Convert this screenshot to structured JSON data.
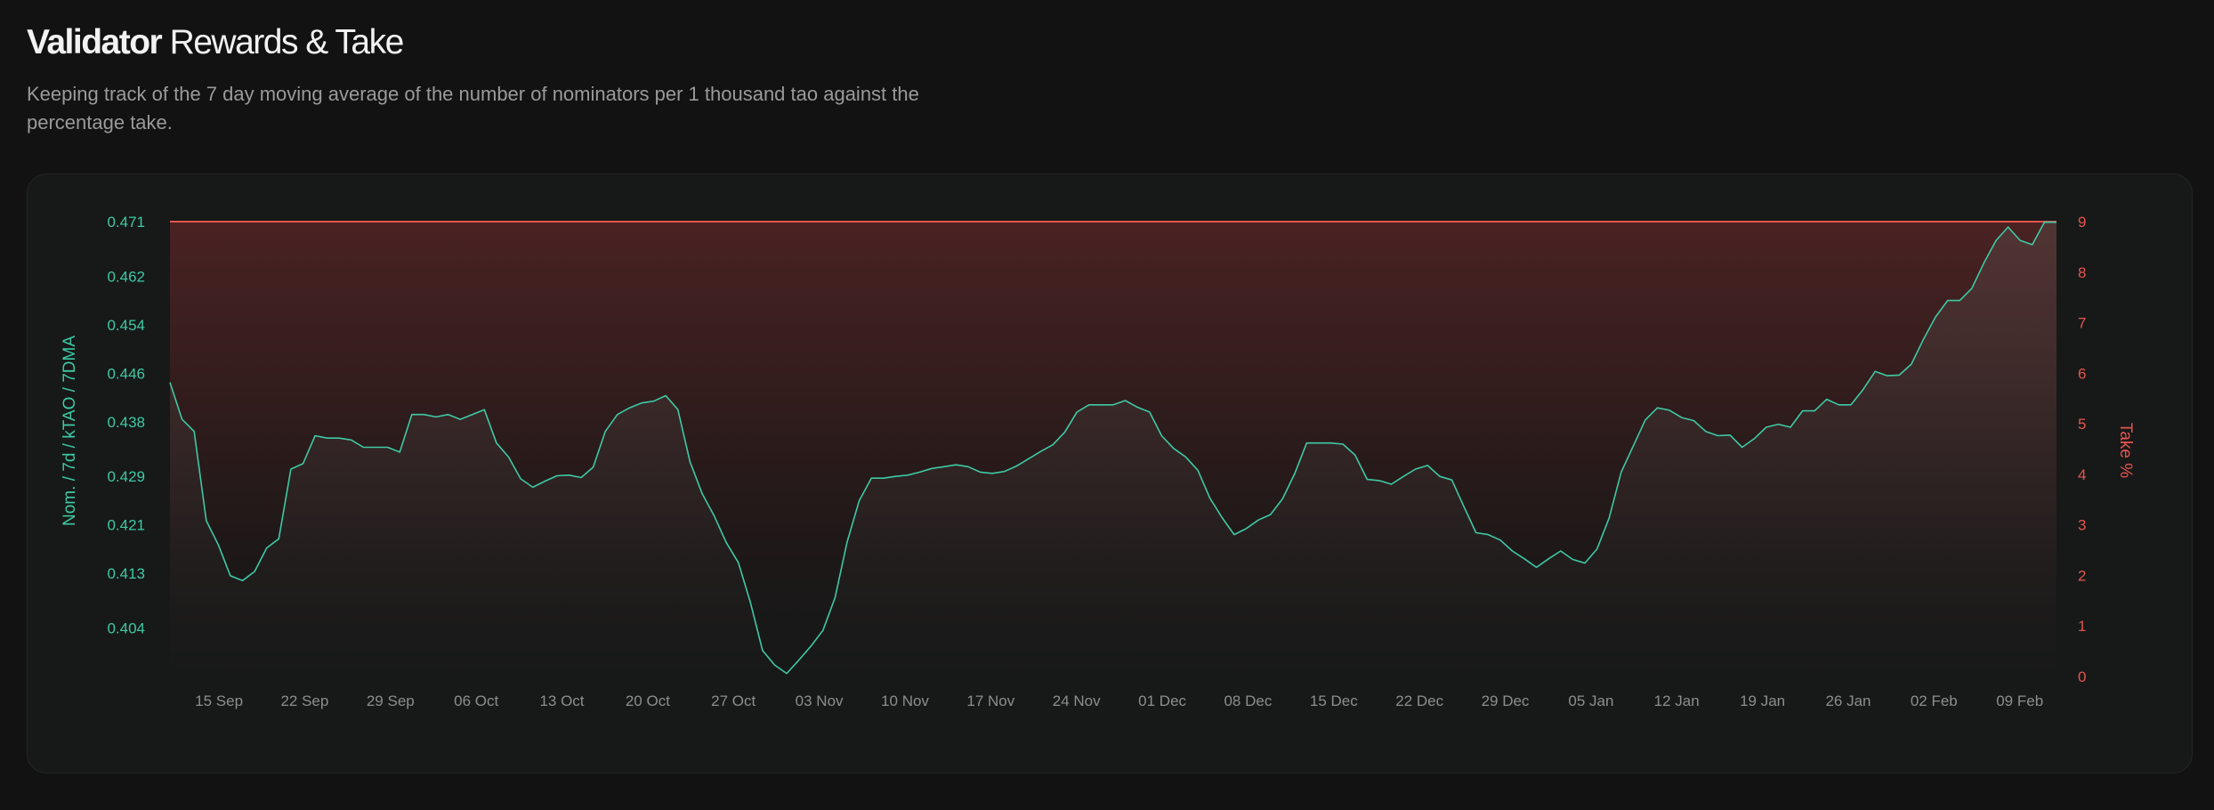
{
  "header": {
    "title_strong": "Validator",
    "title_rest": " Rewards & Take",
    "subtitle": "Keeping track of the 7 day moving average of the number of nominators per 1 thousand tao against the percentage take."
  },
  "colors": {
    "background": "#121212",
    "card": "#171918",
    "nominator_line": "#3ec9a4",
    "take_line": "#e5554d",
    "take_fill_top": "#4a2222",
    "x_tick": "#8d8d8d"
  },
  "chart_data": {
    "type": "line",
    "ylabel_left": "Nom. / 7d / kTAO / 7DMA",
    "ylabel_right": "Take %",
    "y_left_ticks": [
      "0.404",
      "0.413",
      "0.421",
      "0.429",
      "0.438",
      "0.446",
      "0.454",
      "0.462",
      "0.471"
    ],
    "y_left_range": [
      0.396,
      0.471
    ],
    "y_right_ticks": [
      "0",
      "1",
      "2",
      "3",
      "4",
      "5",
      "6",
      "7",
      "8",
      "9"
    ],
    "y_right_range": [
      0,
      9
    ],
    "x_ticks": [
      "15 Sep",
      "22 Sep",
      "29 Sep",
      "06 Oct",
      "13 Oct",
      "20 Oct",
      "27 Oct",
      "03 Nov",
      "10 Nov",
      "17 Nov",
      "24 Nov",
      "01 Dec",
      "08 Dec",
      "15 Dec",
      "22 Dec",
      "29 Dec",
      "05 Jan",
      "12 Jan",
      "19 Jan",
      "26 Jan",
      "02 Feb",
      "09 Feb"
    ],
    "x_start_date": "2023-09-11",
    "x_end_date": "2024-02-12",
    "series": [
      {
        "name": "Nom. / 7d / kTAO / 7DMA",
        "axis": "left",
        "values": [
          0.4445,
          0.4384,
          0.4364,
          0.4217,
          0.4177,
          0.4126,
          0.4118,
          0.4133,
          0.4172,
          0.4187,
          0.4302,
          0.4311,
          0.4357,
          0.4353,
          0.4353,
          0.435,
          0.4338,
          0.4338,
          0.4338,
          0.433,
          0.4392,
          0.4392,
          0.4388,
          0.4392,
          0.4384,
          0.4392,
          0.44,
          0.4345,
          0.4322,
          0.4286,
          0.4272,
          0.4282,
          0.4291,
          0.4292,
          0.4288,
          0.4305,
          0.4364,
          0.4392,
          0.4403,
          0.4411,
          0.4414,
          0.4423,
          0.44,
          0.4314,
          0.4262,
          0.4225,
          0.4181,
          0.4148,
          0.4082,
          0.4003,
          0.3979,
          0.3965,
          0.3987,
          0.401,
          0.4036,
          0.409,
          0.4182,
          0.425,
          0.4287,
          0.4287,
          0.429,
          0.4292,
          0.4297,
          0.4303,
          0.4306,
          0.4309,
          0.4306,
          0.4297,
          0.4295,
          0.4298,
          0.4307,
          0.4319,
          0.4331,
          0.4342,
          0.4363,
          0.4396,
          0.4408,
          0.4408,
          0.4408,
          0.4415,
          0.4404,
          0.4396,
          0.4357,
          0.4336,
          0.4322,
          0.43,
          0.4254,
          0.4222,
          0.4194,
          0.4204,
          0.4218,
          0.4227,
          0.4253,
          0.4294,
          0.4345,
          0.4345,
          0.4345,
          0.4343,
          0.4325,
          0.4285,
          0.4283,
          0.4277,
          0.429,
          0.4302,
          0.4308,
          0.429,
          0.4284,
          0.424,
          0.4197,
          0.4194,
          0.4185,
          0.4167,
          0.4154,
          0.414,
          0.4154,
          0.4167,
          0.4153,
          0.4147,
          0.417,
          0.4221,
          0.4297,
          0.434,
          0.4383,
          0.4403,
          0.4399,
          0.4387,
          0.4382,
          0.4364,
          0.4357,
          0.4358,
          0.4338,
          0.4352,
          0.4371,
          0.4376,
          0.4371,
          0.4398,
          0.4398,
          0.4417,
          0.4408,
          0.4408,
          0.4433,
          0.4463,
          0.4456,
          0.4457,
          0.4475,
          0.4516,
          0.4553,
          0.458,
          0.458,
          0.46,
          0.4642,
          0.4679,
          0.4701,
          0.4679,
          0.4672,
          0.4709,
          0.4709
        ]
      },
      {
        "name": "Take %",
        "axis": "right",
        "values": [
          9,
          9
        ]
      }
    ],
    "grid": false,
    "legend": "none"
  }
}
